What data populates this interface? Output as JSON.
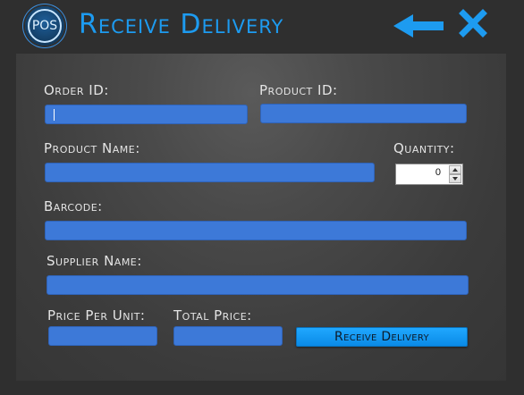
{
  "window": {
    "logo_text": "POS",
    "title": "Receive Delivery",
    "back_icon": "arrow-left-icon",
    "close_icon": "close-x-icon",
    "accent_color": "#1d9bf0",
    "field_color": "#3d79d8"
  },
  "form": {
    "order_id": {
      "label": "Order ID:",
      "value": ""
    },
    "product_id": {
      "label": "Product ID:",
      "value": ""
    },
    "product_name": {
      "label": "Product Name:",
      "value": ""
    },
    "quantity": {
      "label": "Quantity:",
      "value": "0"
    },
    "barcode": {
      "label": "Barcode:",
      "value": ""
    },
    "supplier_name": {
      "label": "Supplier Name:",
      "value": ""
    },
    "price_per_unit": {
      "label": "Price Per Unit:",
      "value": ""
    },
    "total_price": {
      "label": "Total Price:",
      "value": ""
    },
    "submit_label": "Receive Delivery"
  }
}
